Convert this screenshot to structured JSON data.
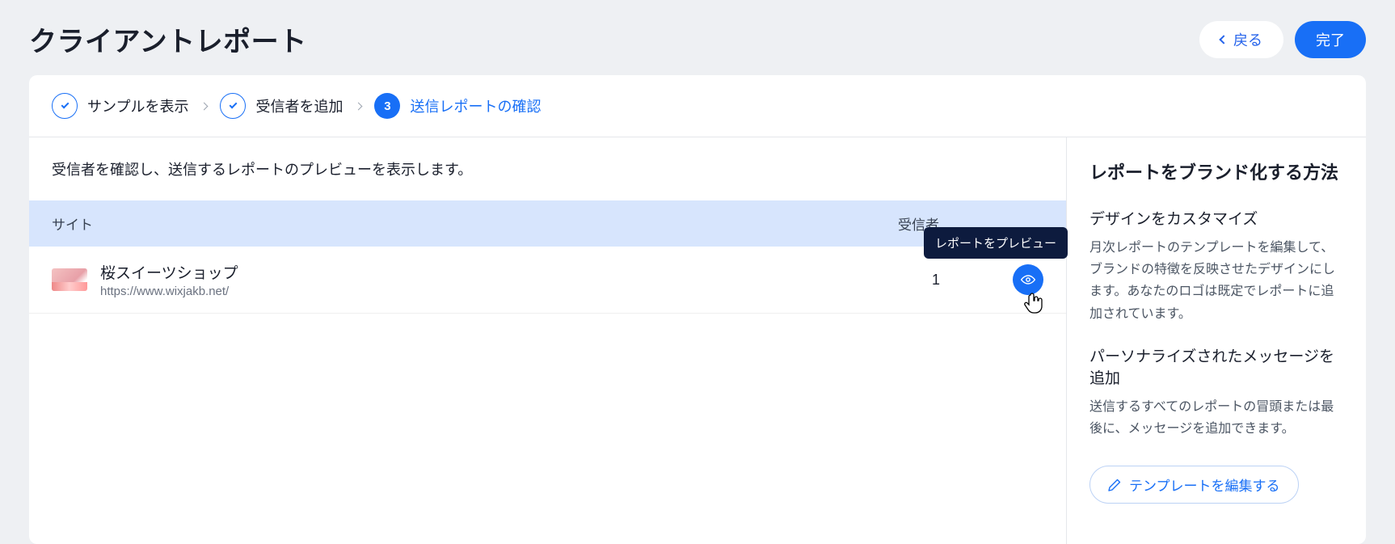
{
  "header": {
    "title": "クライアントレポート",
    "back_label": "戻る",
    "done_label": "完了"
  },
  "steps": [
    {
      "label": "サンプルを表示",
      "state": "done"
    },
    {
      "label": "受信者を追加",
      "state": "done"
    },
    {
      "label": "送信レポートの確認",
      "state": "current",
      "number": "3"
    }
  ],
  "main": {
    "instruction": "受信者を確認し、送信するレポートのプレビューを表示します。",
    "columns": {
      "site": "サイト",
      "recipients": "受信者"
    },
    "rows": [
      {
        "site_name": "桜スイーツショップ",
        "site_url": "https://www.wixjakb.net/",
        "recipient_count": "1"
      }
    ],
    "tooltip": "レポートをプレビュー"
  },
  "sidebar": {
    "title": "レポートをブランド化する方法",
    "sections": [
      {
        "heading": "デザインをカスタマイズ",
        "body": "月次レポートのテンプレートを編集して、ブランドの特徴を反映させたデザインにします。あなたのロゴは既定でレポートに追加されています。"
      },
      {
        "heading": "パーソナライズされたメッセージを追加",
        "body": "送信するすべてのレポートの冒頭または最後に、メッセージを追加できます。"
      }
    ],
    "edit_template_label": "テンプレートを編集する"
  }
}
